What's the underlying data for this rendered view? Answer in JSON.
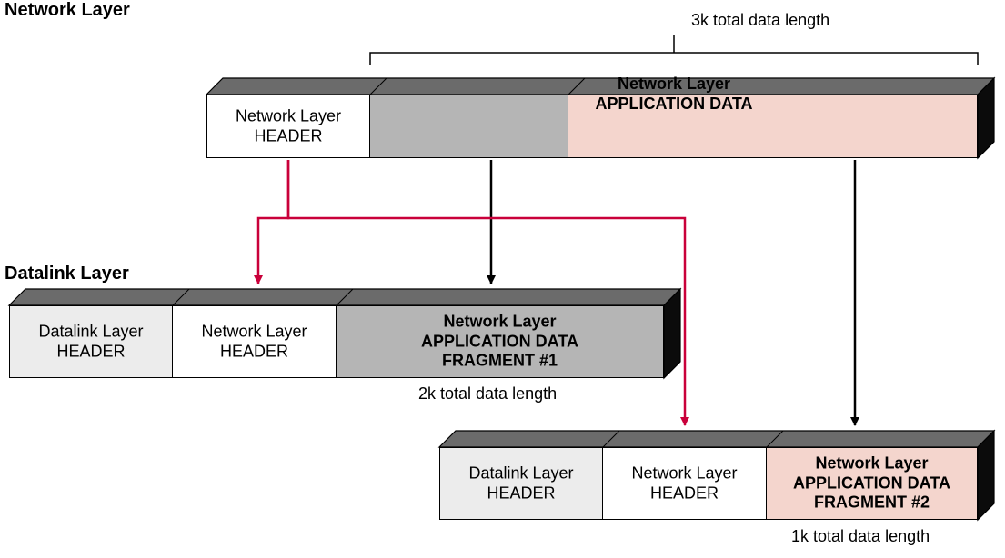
{
  "headings": {
    "network_layer": "Network Layer",
    "datalink_layer": "Datalink Layer"
  },
  "annotations": {
    "top_data_len": "3k total data length",
    "frag1_len": "2k total data length",
    "frag2_len": "1k total data length"
  },
  "top_block": {
    "seg1": {
      "line1": "Network Layer",
      "line2": "HEADER"
    },
    "seg2": {
      "line1": "Network Layer",
      "line2": "APPLICATION DATA"
    }
  },
  "frag1_block": {
    "seg1": {
      "line1": "Datalink Layer",
      "line2": "HEADER"
    },
    "seg2": {
      "line1": "Network Layer",
      "line2": "HEADER"
    },
    "seg3": {
      "line1": "Network Layer",
      "line2": "APPLICATION DATA",
      "line3": "FRAGMENT #1"
    }
  },
  "frag2_block": {
    "seg1": {
      "line1": "Datalink Layer",
      "line2": "HEADER"
    },
    "seg2": {
      "line1": "Network Layer",
      "line2": "HEADER"
    },
    "seg3": {
      "line1": "Network Layer",
      "line2": "APPLICATION DATA",
      "line3": "FRAGMENT #2"
    }
  },
  "colors": {
    "top_dark": "#6b6b6b",
    "side_dark": "#0b0b0b",
    "seg_white": "#ffffff",
    "seg_lightgrey": "#ececec",
    "seg_midgrey": "#b5b5b5",
    "seg_pink": "#f4d5cd",
    "stroke": "#000000",
    "red_arrow": "#c9003a"
  }
}
